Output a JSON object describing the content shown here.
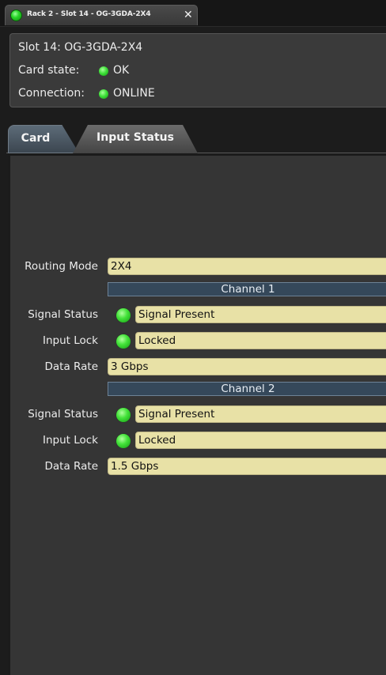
{
  "window_tab": {
    "title": "Rack 2 - Slot 14 - OG-3GDA-2X4",
    "close_glyph": "✕",
    "status_color": "#2ad62a"
  },
  "info": {
    "slot": "Slot 14: OG-3GDA-2X4",
    "card_state_label": "Card state:",
    "card_state_value": "OK",
    "connection_label": "Connection:",
    "connection_value": "ONLINE"
  },
  "tabs": [
    {
      "label": "Card",
      "selected": false
    },
    {
      "label": "Input Status",
      "selected": true
    }
  ],
  "status": {
    "routing_mode_label": "Routing Mode",
    "routing_mode_value": "2X4",
    "channels": [
      {
        "header": "Channel 1",
        "signal_status_label": "Signal Status",
        "signal_status_value": "Signal Present",
        "input_lock_label": "Input Lock",
        "input_lock_value": "Locked",
        "data_rate_label": "Data Rate",
        "data_rate_value": "3 Gbps"
      },
      {
        "header": "Channel 2",
        "signal_status_label": "Signal Status",
        "signal_status_value": "Signal Present",
        "input_lock_label": "Input Lock",
        "input_lock_value": "Locked",
        "data_rate_label": "Data Rate",
        "data_rate_value": "1.5 Gbps"
      }
    ]
  },
  "colors": {
    "field_bg": "#e8e1a6",
    "header_bg": "#35485a",
    "led_green": "#44e33a"
  }
}
